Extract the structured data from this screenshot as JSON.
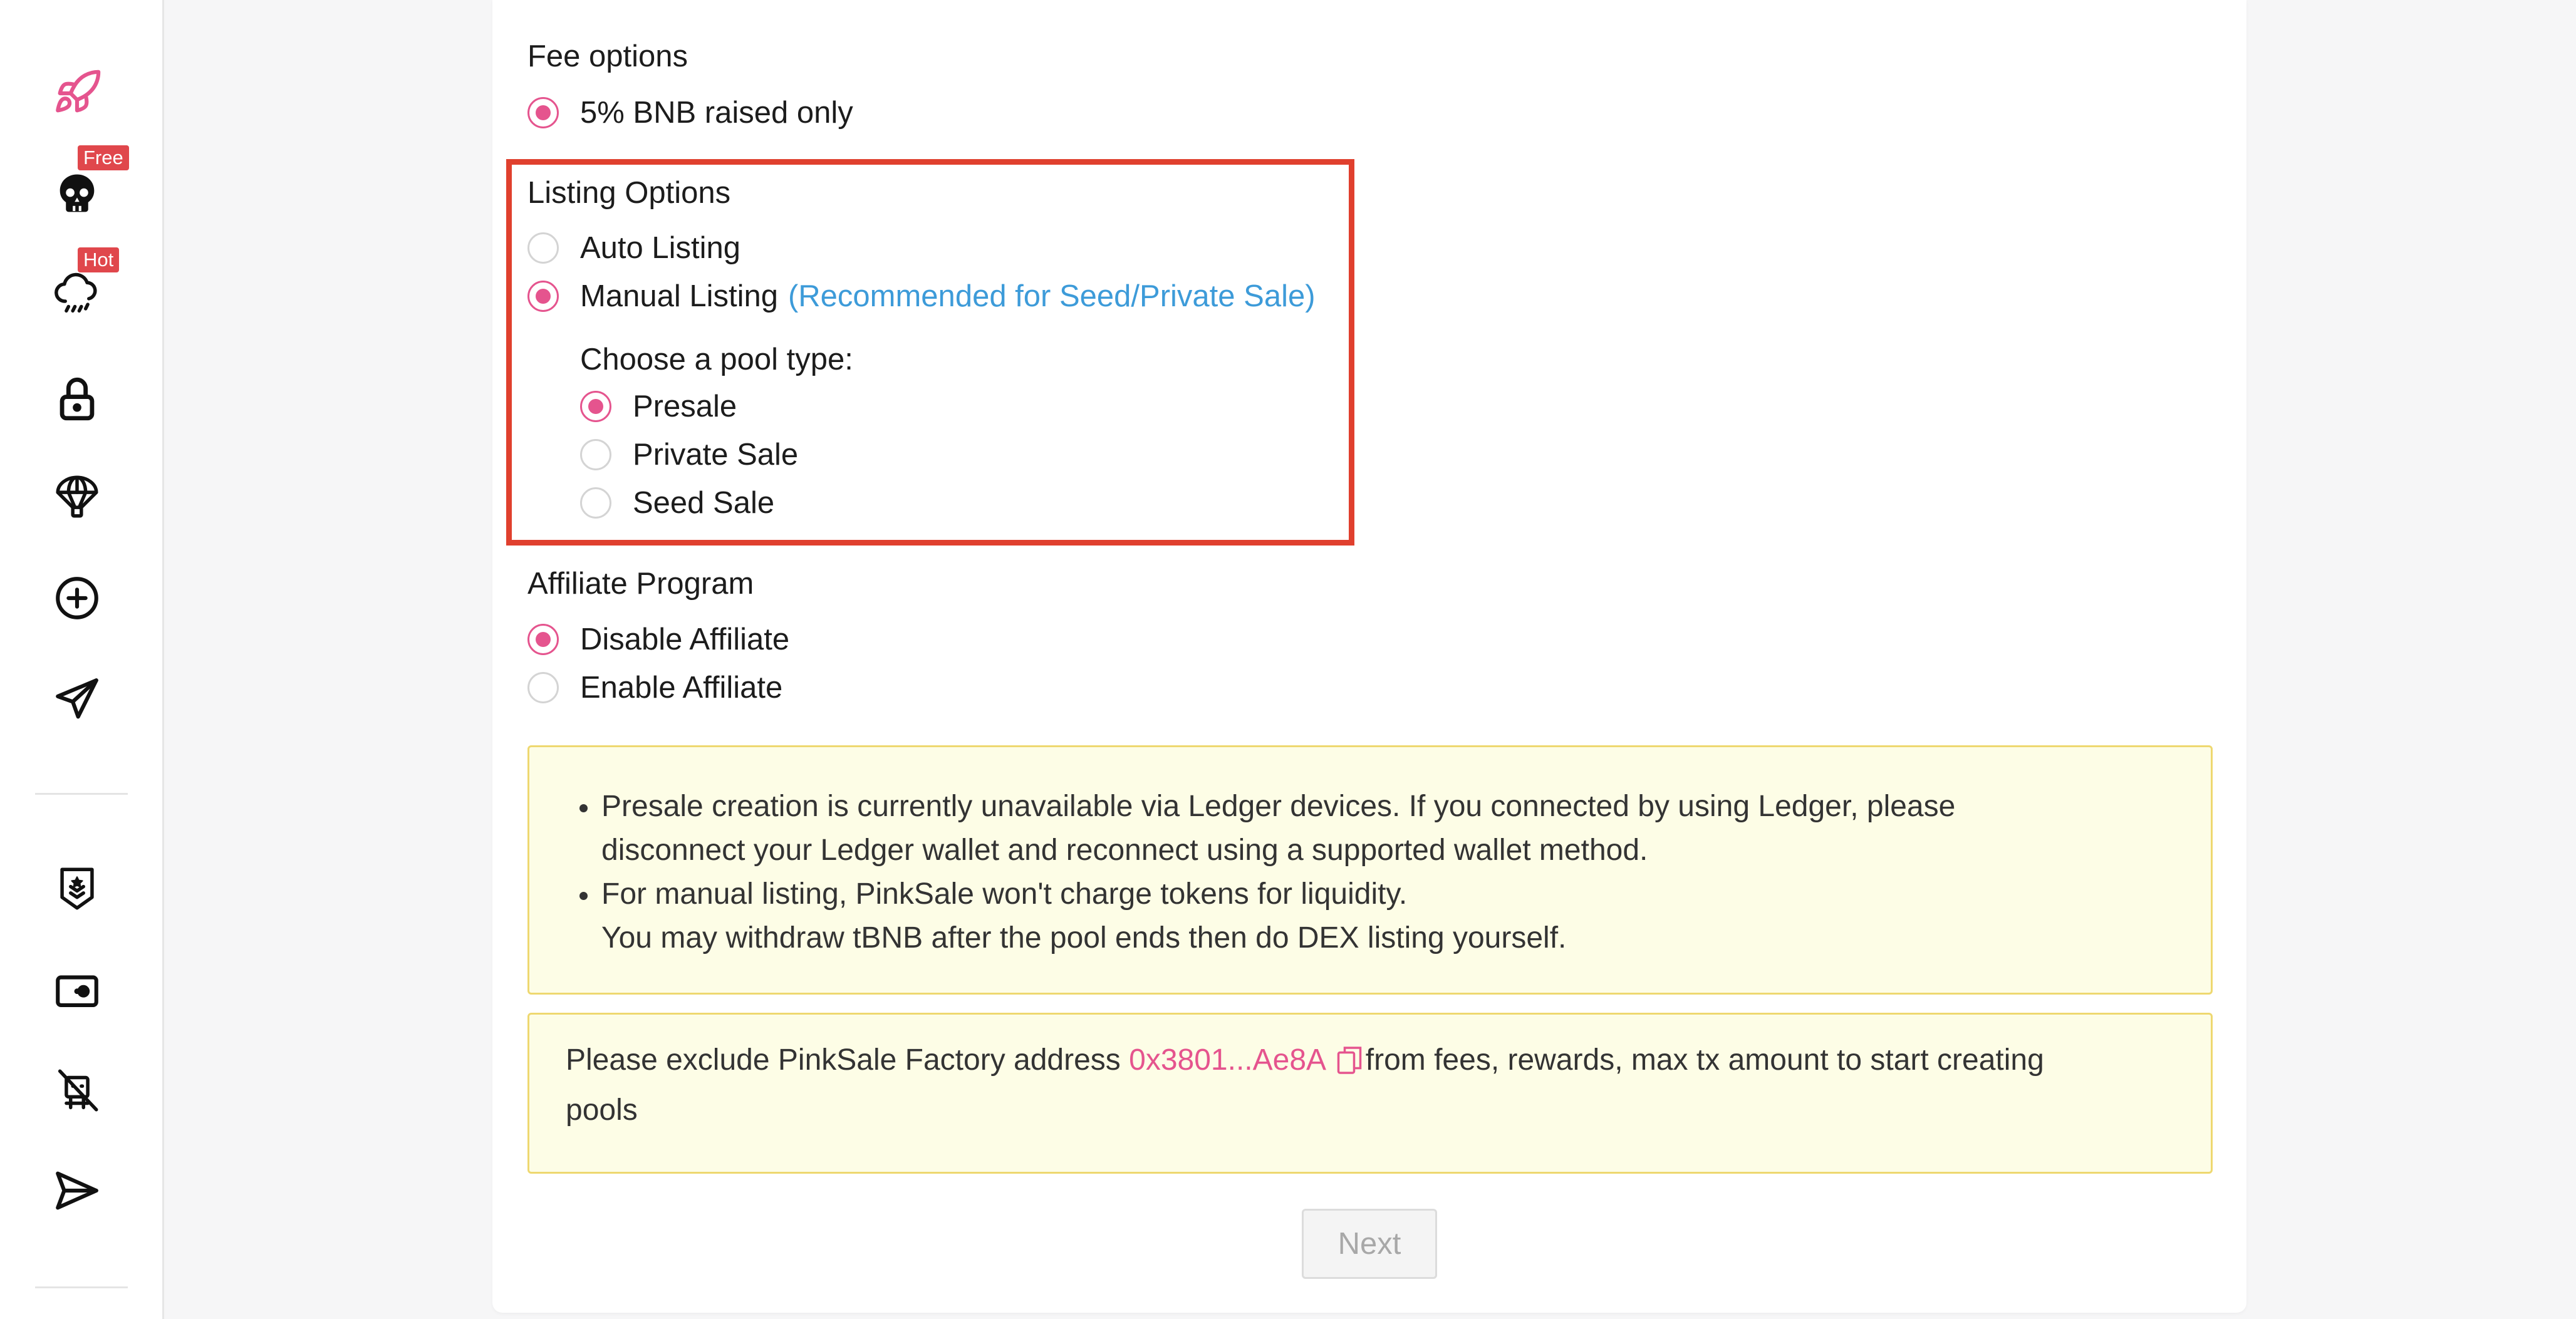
{
  "sidebar": {
    "icons": [
      {
        "name": "rocket-icon",
        "color": "#e5548e"
      },
      {
        "name": "skull-icon",
        "badge": "Free"
      },
      {
        "name": "rain-cloud-icon",
        "badge": "Hot"
      },
      {
        "name": "lock-icon"
      },
      {
        "name": "parachute-icon"
      },
      {
        "name": "plus-circle-icon"
      },
      {
        "name": "paper-plane-icon"
      },
      {
        "name": "rank-shield-icon"
      },
      {
        "name": "id-card-icon"
      },
      {
        "name": "no-bot-icon"
      },
      {
        "name": "send-icon"
      }
    ],
    "badge_color": "#e0474c"
  },
  "fee": {
    "label": "Fee options",
    "options": [
      {
        "label": "5% BNB raised only",
        "checked": true
      }
    ]
  },
  "listing": {
    "label": "Listing Options",
    "options": [
      {
        "label": "Auto Listing",
        "checked": false
      },
      {
        "label": "Manual Listing",
        "hint": "(Recommended for Seed/Private Sale)",
        "checked": true
      }
    ],
    "pool_type_label": "Choose a pool type:",
    "pool_types": [
      {
        "label": "Presale",
        "checked": true
      },
      {
        "label": "Private Sale",
        "checked": false
      },
      {
        "label": "Seed Sale",
        "checked": false
      }
    ]
  },
  "affiliate": {
    "label": "Affiliate Program",
    "options": [
      {
        "label": "Disable Affiliate",
        "checked": true
      },
      {
        "label": "Enable Affiliate",
        "checked": false
      }
    ]
  },
  "notice": {
    "items": [
      {
        "lines": [
          "Presale creation is currently unavailable via Ledger devices. If you connected by using Ledger, please",
          "disconnect your Ledger wallet and reconnect using a supported wallet method."
        ]
      },
      {
        "lines": [
          "For manual listing, PinkSale won't charge tokens for liquidity.",
          "You may withdraw tBNB after the pool ends then do DEX listing yourself."
        ]
      }
    ]
  },
  "exclude": {
    "prefix": "Please exclude PinkSale Factory address",
    "address": "0x3801...Ae8A",
    "suffix_line1": "from fees, rewards, max tx amount to start creating",
    "suffix_line2": "pools"
  },
  "next_label": "Next",
  "colors": {
    "accent": "#e5548e",
    "hint": "#3d9bd9",
    "highlight": "#e0402e",
    "alert_bg": "#fdfde6",
    "alert_border": "#eed870"
  }
}
